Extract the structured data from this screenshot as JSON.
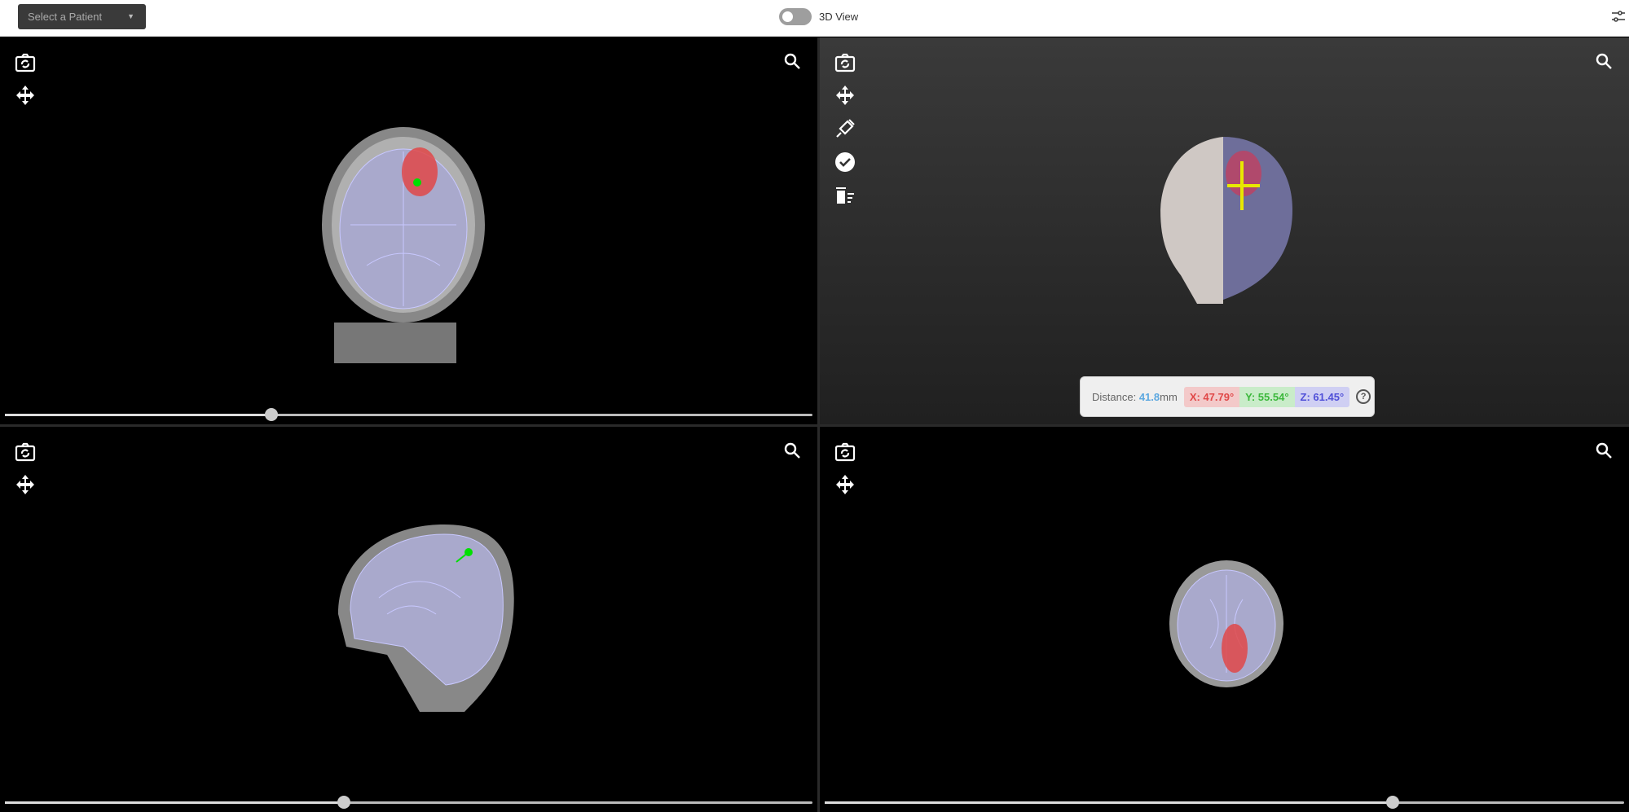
{
  "topbar": {
    "patient_select": "Select a Patient",
    "toggle_label": "3D View",
    "toggle_on": false
  },
  "viewports": {
    "coronal": {
      "slice_fraction": 0.33
    },
    "sagittal": {
      "slice_fraction": 0.42
    },
    "axial": {
      "slice_fraction": 0.71
    }
  },
  "measurement": {
    "distance_label": "Distance:",
    "distance_value": "41.8",
    "distance_unit": "mm",
    "x": "X: 47.79°",
    "y": "Y: 55.54°",
    "z": "Z: 61.45°",
    "help": "?"
  },
  "colors": {
    "segmentation": "#e04848",
    "brain_outline": "#a8a8e8",
    "marker": "#00e000"
  }
}
